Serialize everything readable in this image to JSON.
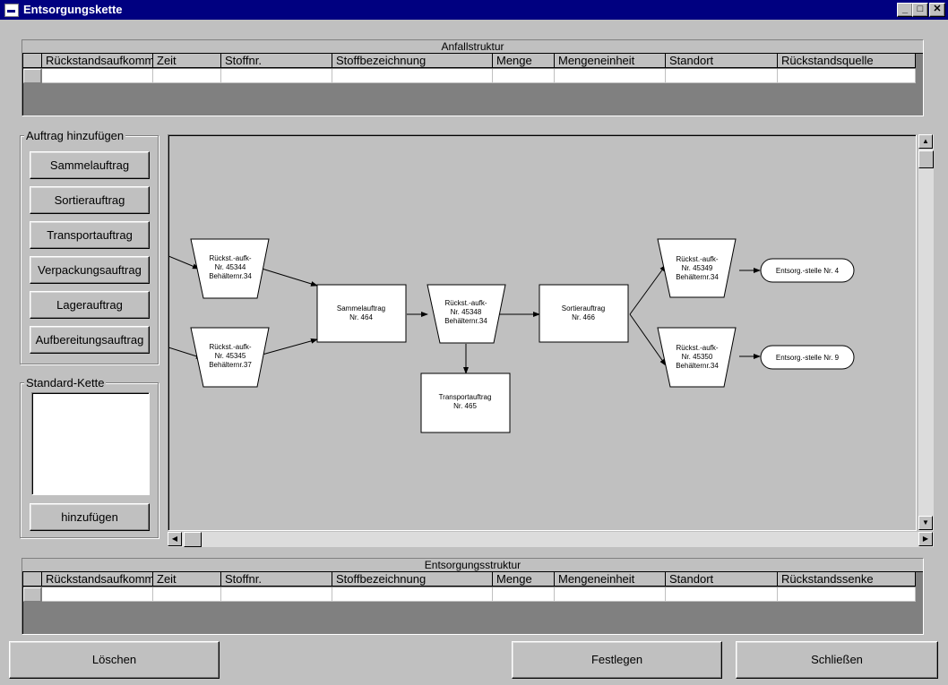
{
  "window": {
    "title": "Entsorgungskette",
    "min": "_",
    "max": "□",
    "close": "✕"
  },
  "anfall": {
    "caption": "Anfallstruktur",
    "columns": [
      "Rückstandsaufkomm",
      "Zeit",
      "Stoffnr.",
      "Stoffbezeichnung",
      "Menge",
      "Mengeneinheit",
      "Standort",
      "Rückstandsquelle"
    ]
  },
  "entsorgung": {
    "caption": "Entsorgungsstruktur",
    "columns": [
      "Rückstandsaufkomm",
      "Zeit",
      "Stoffnr.",
      "Stoffbezeichnung",
      "Menge",
      "Mengeneinheit",
      "Standort",
      "Rückstandssenke"
    ]
  },
  "auftrag": {
    "group_label": "Auftrag hinzufügen",
    "buttons": [
      "Sammelauftrag",
      "Sortierauftrag",
      "Transportauftrag",
      "Verpackungsauftrag",
      "Lagerauftrag",
      "Aufbereitungsauftrag"
    ]
  },
  "standard": {
    "group_label": "Standard-Kette",
    "add_button": "hinzufügen"
  },
  "diagram": {
    "nodes": {
      "t1": [
        "Rückst.-aufk-",
        "Nr. 45344",
        "Behälternr.34"
      ],
      "t2": [
        "Rückst.-aufk-",
        "Nr. 45345",
        "Behälternr.37"
      ],
      "sammel": [
        "Sammelauftrag",
        "Nr. 464"
      ],
      "t3": [
        "Rückst.-aufk-",
        "Nr. 45348",
        "Behälternr.34"
      ],
      "transport": [
        "Transportauftrag",
        "Nr. 465"
      ],
      "sortier": [
        "Sortierauftrag",
        "Nr. 466"
      ],
      "t4": [
        "Rückst.-aufk-",
        "Nr. 45349",
        "Behälternr.34"
      ],
      "t5": [
        "Rückst.-aufk-",
        "Nr. 45350",
        "Behälternr.34"
      ],
      "e1": [
        "Entsorg.-stelle Nr. 4"
      ],
      "e2": [
        "Entsorg.-stelle Nr. 9"
      ]
    }
  },
  "footer": {
    "delete": "Löschen",
    "set": "Festlegen",
    "close": "Schließen"
  },
  "icons": {
    "scroll_up": "up-arrow-icon",
    "scroll_down": "down-arrow-icon",
    "scroll_left": "left-arrow-icon",
    "scroll_right": "right-arrow-icon"
  }
}
